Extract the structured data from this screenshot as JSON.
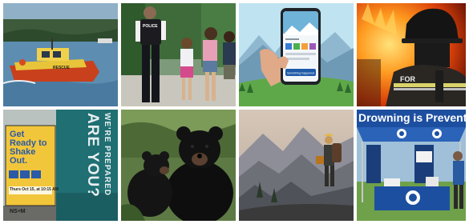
{
  "tiles": {
    "rescue_boat": {
      "boat_label": "RESCUE"
    },
    "police_officer": {
      "vest_label": "POLICE"
    },
    "phone_app": {
      "screen_button": "Something happened"
    },
    "firefighter": {
      "coat_label": "FOR"
    },
    "shakeout": {
      "sign_line1": "Get",
      "sign_line2": "Ready to",
      "sign_line3": "Shake",
      "sign_line4": "Out.",
      "sign_date": "Thurs Oct 15, at 10:15 AM",
      "sign_footer": "NS≡M",
      "banner_line1": "WE'RE PREPARED",
      "banner_line2": "ARE YOU?"
    },
    "drowning_booth": {
      "banner_text": "Drowning is Preventa"
    }
  },
  "colors": {
    "sign_yellow": "#f2c63a",
    "banner_teal": "#1f6f73",
    "booth_blue": "#1d4fa0"
  }
}
